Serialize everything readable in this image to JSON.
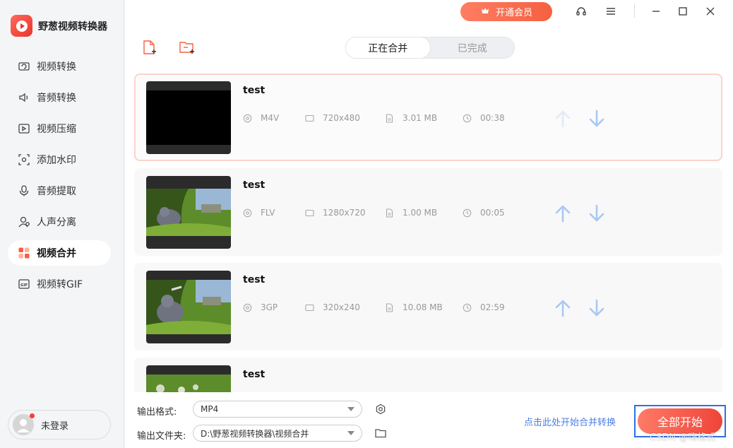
{
  "app": {
    "name": "野葱视频转换器"
  },
  "sidebar": {
    "items": [
      {
        "label": "视频转换",
        "icon": "video-convert-icon"
      },
      {
        "label": "音频转换",
        "icon": "audio-convert-icon"
      },
      {
        "label": "视频压缩",
        "icon": "video-compress-icon"
      },
      {
        "label": "添加水印",
        "icon": "watermark-icon"
      },
      {
        "label": "音频提取",
        "icon": "audio-extract-icon"
      },
      {
        "label": "人声分离",
        "icon": "vocal-separate-icon"
      },
      {
        "label": "视频合并",
        "icon": "video-merge-icon",
        "active": true
      },
      {
        "label": "视频转GIF",
        "icon": "gif-icon"
      }
    ],
    "user": {
      "label": "未登录"
    }
  },
  "topbar": {
    "vip_label": "开通会员"
  },
  "tabs": [
    {
      "label": "正在合并",
      "active": true
    },
    {
      "label": "已完成",
      "active": false
    }
  ],
  "files": [
    {
      "name": "test",
      "format": "M4V",
      "resolution": "720x480",
      "size": "3.01 MB",
      "duration": "00:38"
    },
    {
      "name": "test",
      "format": "FLV",
      "resolution": "1280x720",
      "size": "1.00 MB",
      "duration": "00:05"
    },
    {
      "name": "test",
      "format": "3GP",
      "resolution": "320x240",
      "size": "10.08 MB",
      "duration": "02:59"
    },
    {
      "name": "test"
    }
  ],
  "bottom": {
    "format_label": "输出格式:",
    "format_value": "MP4",
    "folder_label": "输出文件夹:",
    "folder_value": "D:\\野葱视频转换器\\视频合并",
    "merge_link": "点击此处开始合并转换",
    "start_button": "全部开始",
    "watermark": "CSDN @嗨格式"
  },
  "colors": {
    "accent": "#f4613f",
    "link": "#4b7ee8",
    "arrow": "#a9c8f2"
  }
}
